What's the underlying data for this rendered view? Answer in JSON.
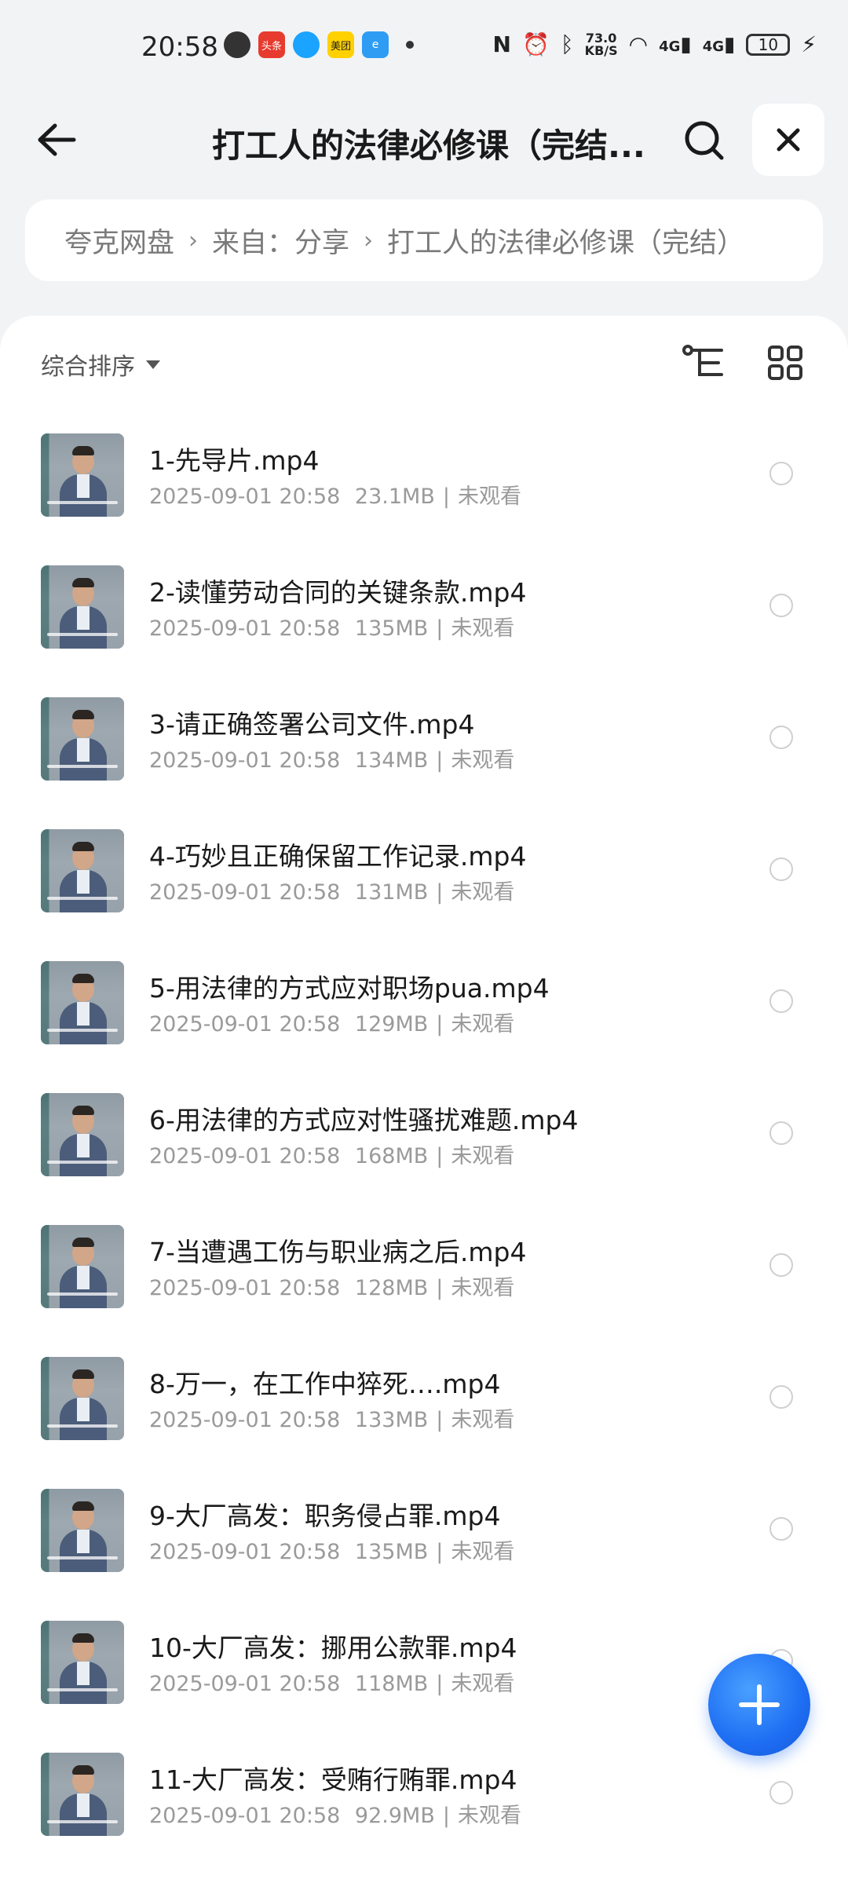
{
  "status_bar": {
    "time": "20:58",
    "net_speed_value": "73.0",
    "net_speed_unit": "KB/S",
    "signal1": "4G",
    "signal2": "4G",
    "battery": "10",
    "app_badges": [
      "头条",
      "美团"
    ]
  },
  "header": {
    "title": "打工人的法律必修课（完结...",
    "back_icon": "arrow-left-icon",
    "search_icon": "search-icon",
    "close_icon": "close-icon"
  },
  "breadcrumb": {
    "items": [
      "夸克网盘",
      "来自：分享",
      "打工人的法律必修课（完结）"
    ]
  },
  "toolbar": {
    "sort_label": "综合排序",
    "tree_icon": "tree-view-icon",
    "grid_icon": "grid-view-icon"
  },
  "files": [
    {
      "name": "1-先导片.mp4",
      "date": "2025-09-01 20:58",
      "size": "23.1MB",
      "status": "未观看"
    },
    {
      "name": "2-读懂劳动合同的关键条款.mp4",
      "date": "2025-09-01 20:58",
      "size": "135MB",
      "status": "未观看"
    },
    {
      "name": "3-请正确签署公司文件.mp4",
      "date": "2025-09-01 20:58",
      "size": "134MB",
      "status": "未观看"
    },
    {
      "name": "4-巧妙且正确保留工作记录.mp4",
      "date": "2025-09-01 20:58",
      "size": "131MB",
      "status": "未观看"
    },
    {
      "name": "5-用法律的方式应对职场pua.mp4",
      "date": "2025-09-01 20:58",
      "size": "129MB",
      "status": "未观看"
    },
    {
      "name": "6-用法律的方式应对性骚扰难题.mp4",
      "date": "2025-09-01 20:58",
      "size": "168MB",
      "status": "未观看"
    },
    {
      "name": "7-当遭遇工伤与职业病之后.mp4",
      "date": "2025-09-01 20:58",
      "size": "128MB",
      "status": "未观看"
    },
    {
      "name": "8-万一，在工作中猝死….mp4",
      "date": "2025-09-01 20:58",
      "size": "133MB",
      "status": "未观看"
    },
    {
      "name": "9-大厂高发：职务侵占罪.mp4",
      "date": "2025-09-01 20:58",
      "size": "135MB",
      "status": "未观看"
    },
    {
      "name": "10-大厂高发：挪用公款罪.mp4",
      "date": "2025-09-01 20:58",
      "size": "118MB",
      "status": "未观看"
    },
    {
      "name": "11-大厂高发：受贿行贿罪.mp4",
      "date": "2025-09-01 20:58",
      "size": "92.9MB",
      "status": "未观看"
    }
  ],
  "fab": {
    "icon": "plus-icon"
  }
}
